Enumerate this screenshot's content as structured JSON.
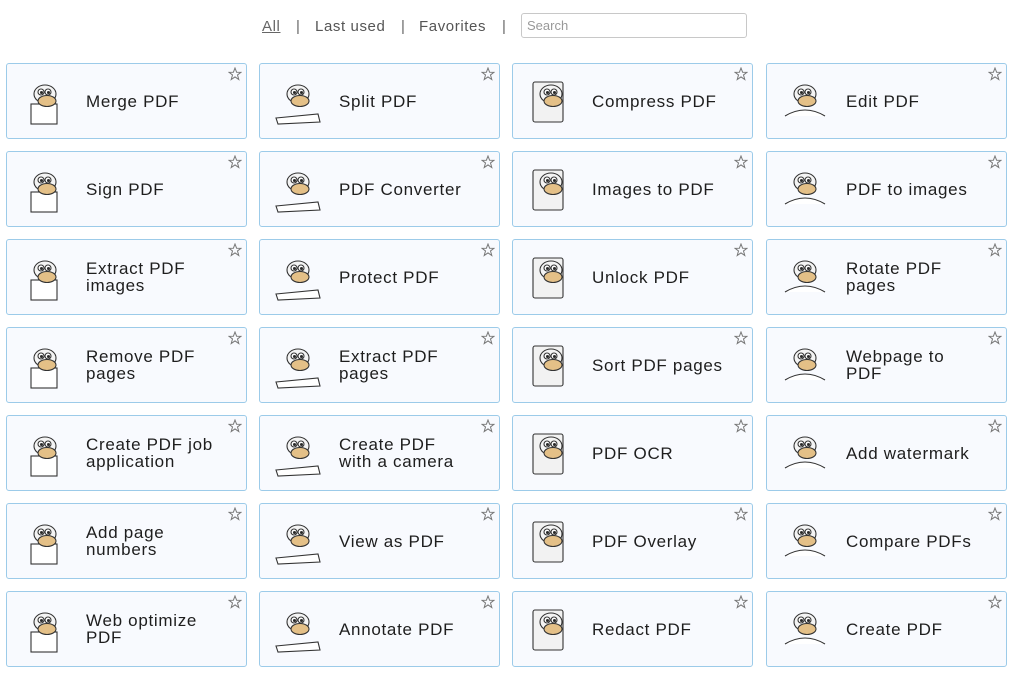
{
  "nav": {
    "links": [
      {
        "label": "All",
        "active": true
      },
      {
        "label": "Last used",
        "active": false
      },
      {
        "label": "Favorites",
        "active": false
      }
    ],
    "separator": "|",
    "search": {
      "value": "",
      "placeholder": "Search"
    }
  },
  "tools": [
    {
      "label": "Merge PDF",
      "icon": "merge-pdf-illustration"
    },
    {
      "label": "Split PDF",
      "icon": "split-pdf-illustration"
    },
    {
      "label": "Compress PDF",
      "icon": "compress-pdf-illustration"
    },
    {
      "label": "Edit PDF",
      "icon": "edit-pdf-illustration"
    },
    {
      "label": "Sign PDF",
      "icon": "sign-pdf-illustration"
    },
    {
      "label": "PDF Converter",
      "icon": "pdf-converter-illustration"
    },
    {
      "label": "Images to PDF",
      "icon": "images-to-pdf-illustration"
    },
    {
      "label": "PDF to images",
      "icon": "pdf-to-images-illustration"
    },
    {
      "label": "Extract PDF images",
      "icon": "extract-pdf-images-illustration"
    },
    {
      "label": "Protect PDF",
      "icon": "protect-pdf-illustration"
    },
    {
      "label": "Unlock PDF",
      "icon": "unlock-pdf-illustration"
    },
    {
      "label": "Rotate PDF pages",
      "icon": "rotate-pdf-pages-illustration"
    },
    {
      "label": "Remove PDF pages",
      "icon": "remove-pdf-pages-illustration"
    },
    {
      "label": "Extract PDF pages",
      "icon": "extract-pdf-pages-illustration"
    },
    {
      "label": "Sort PDF pages",
      "icon": "sort-pdf-pages-illustration"
    },
    {
      "label": "Webpage to PDF",
      "icon": "webpage-to-pdf-illustration"
    },
    {
      "label": "Create PDF job application",
      "icon": "job-application-illustration"
    },
    {
      "label": "Create PDF with a camera",
      "icon": "camera-illustration"
    },
    {
      "label": "PDF OCR",
      "icon": "pdf-ocr-illustration"
    },
    {
      "label": "Add watermark",
      "icon": "watermark-illustration"
    },
    {
      "label": "Add page numbers",
      "icon": "page-numbers-illustration"
    },
    {
      "label": "View as PDF",
      "icon": "magnifier-illustration"
    },
    {
      "label": "PDF Overlay",
      "icon": "pdf-overlay-illustration"
    },
    {
      "label": "Compare PDFs",
      "icon": "compare-pdfs-illustration"
    },
    {
      "label": "Web optimize PDF",
      "icon": "web-optimize-illustration"
    },
    {
      "label": "Annotate PDF",
      "icon": "annotate-pdf-illustration"
    },
    {
      "label": "Redact PDF",
      "icon": "redact-pdf-illustration"
    },
    {
      "label": "Create PDF",
      "icon": "create-pdf-illustration"
    }
  ],
  "colors": {
    "card_border": "#9ccbe9",
    "card_background": "#f8fafe",
    "mascot_beak": "#e4c087"
  }
}
